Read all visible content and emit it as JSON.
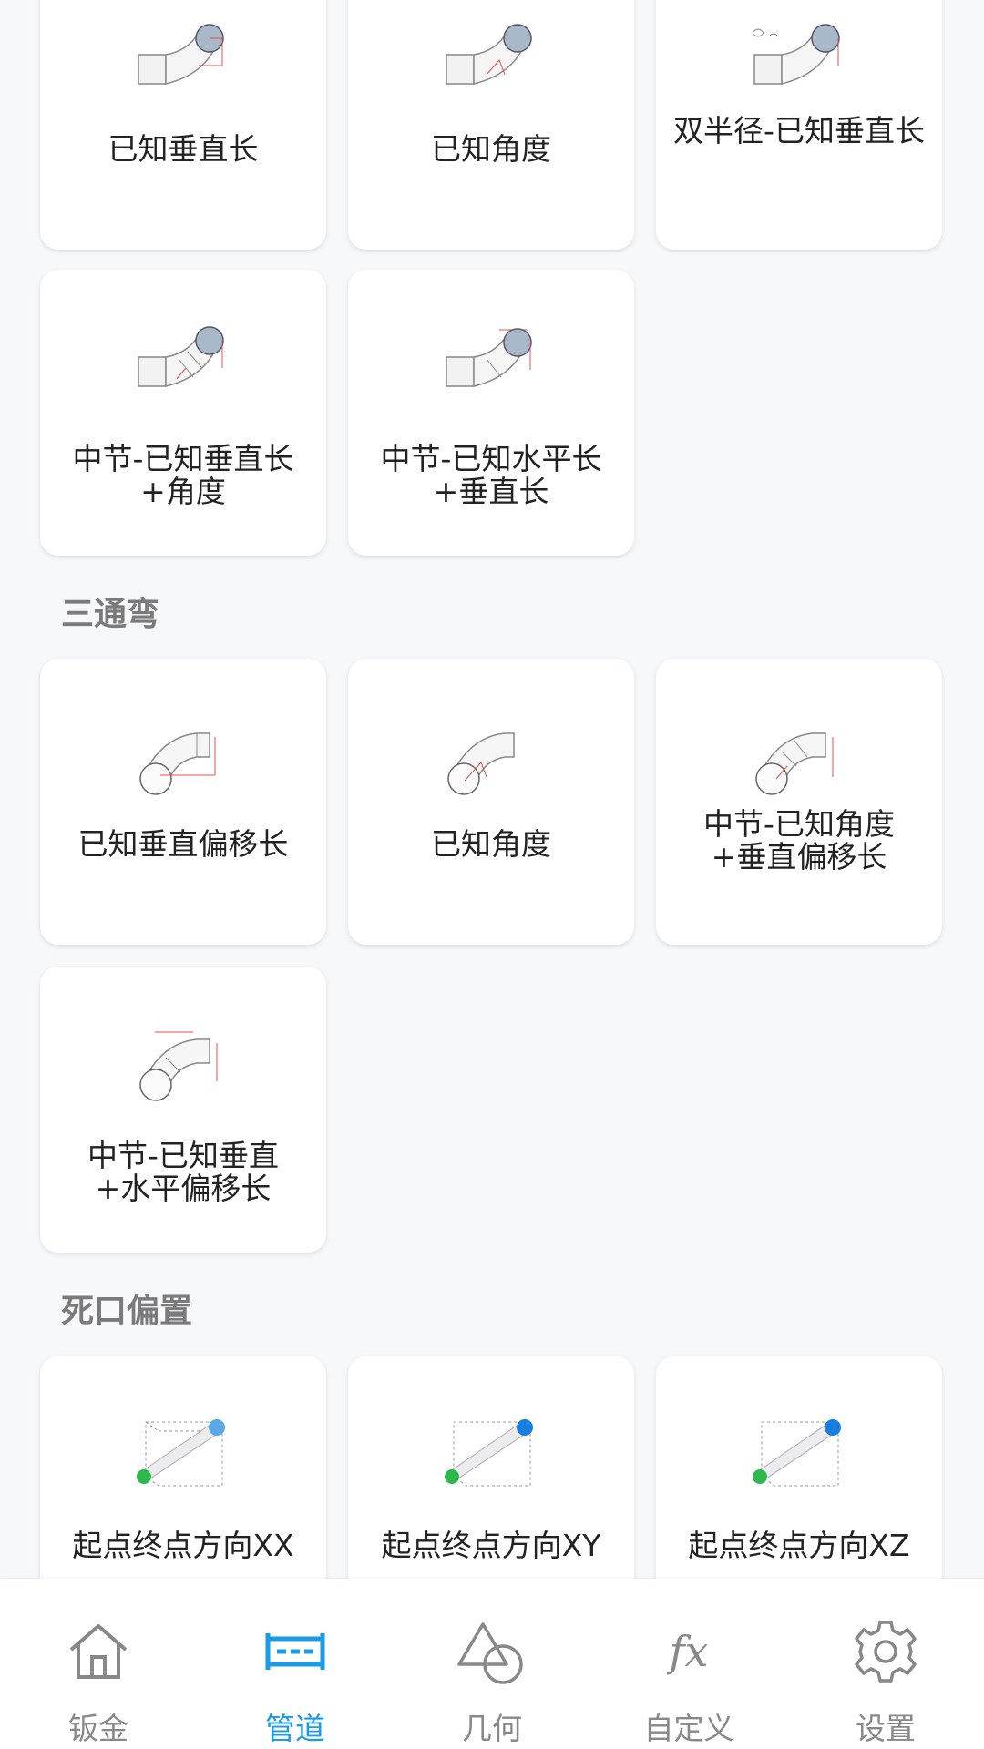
{
  "colors": {
    "accent": "#1a9be6",
    "section_text": "#7a7a7a",
    "tab_inactive": "#888888",
    "pipe_red": "#e05050"
  },
  "sections": {
    "top_cards": [
      {
        "label": "已知垂直长",
        "icon": "elbow-pipe-icon"
      },
      {
        "label": "已知角度",
        "icon": "elbow-pipe-icon"
      },
      {
        "label": "双半径-已知垂直长",
        "icon": "elbow-pipe-icon"
      },
      {
        "label": "中节-已知垂直长\n+角度",
        "icon": "elbow-pipe-icon"
      },
      {
        "label": "中节-已知水平长\n+垂直长",
        "icon": "elbow-pipe-icon"
      }
    ],
    "tee": {
      "title": "三通弯",
      "cards": [
        {
          "label": "已知垂直偏移长",
          "icon": "tee-bend-icon"
        },
        {
          "label": "已知角度",
          "icon": "tee-bend-icon"
        },
        {
          "label": "中节-已知角度\n+垂直偏移长",
          "icon": "tee-bend-icon"
        },
        {
          "label": "中节-已知垂直\n+水平偏移长",
          "icon": "tee-bend-icon"
        }
      ]
    },
    "dead_end": {
      "title": "死口偏置",
      "cards": [
        {
          "label": "起点终点方向XX",
          "icon": "offset-box-icon"
        },
        {
          "label": "起点终点方向XY",
          "icon": "offset-box-icon"
        },
        {
          "label": "起点终点方向XZ",
          "icon": "offset-box-icon"
        }
      ]
    }
  },
  "tabs": [
    {
      "label": "钣金",
      "icon": "home-icon",
      "active": false
    },
    {
      "label": "管道",
      "icon": "pipe-icon",
      "active": true
    },
    {
      "label": "几何",
      "icon": "geometry-icon",
      "active": false
    },
    {
      "label": "自定义",
      "icon": "fx-icon",
      "active": false
    },
    {
      "label": "设置",
      "icon": "gear-icon",
      "active": false
    }
  ]
}
